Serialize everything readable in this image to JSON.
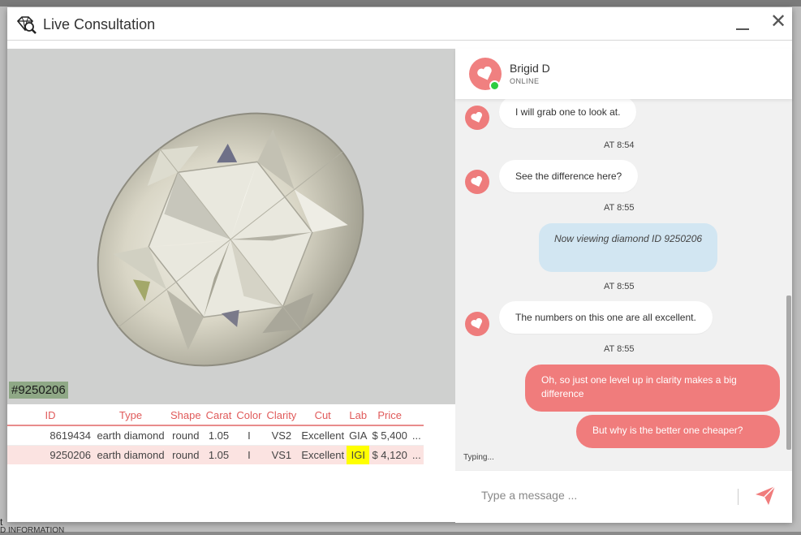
{
  "window": {
    "title": "Live Consultation"
  },
  "viewer": {
    "diamond_id_tag": "#9250206"
  },
  "table": {
    "headers": [
      "ID",
      "Type",
      "Shape",
      "Carat",
      "Color",
      "Clarity",
      "Cut",
      "Lab",
      "Price"
    ],
    "rows": [
      [
        "8619434",
        "earth diamond",
        "round",
        "1.05",
        "I",
        "VS2",
        "Excellent",
        "GIA",
        "$ 5,400",
        "..."
      ],
      [
        "9250206",
        "earth diamond",
        "round",
        "1.05",
        "I",
        "VS1",
        "Excellent",
        "IGI",
        "$ 4,120",
        "..."
      ]
    ]
  },
  "agent": {
    "name": "Brigid D",
    "status": "ONLINE"
  },
  "messages": [
    {
      "from": "agent",
      "text": "I will grab one to look at."
    },
    {
      "type": "timestamp",
      "text": "AT 8:54"
    },
    {
      "from": "agent",
      "text": "See the difference here?"
    },
    {
      "type": "timestamp",
      "text": "AT 8:55"
    },
    {
      "from": "system",
      "text": "Now viewing diamond ID 9250206"
    },
    {
      "type": "timestamp",
      "text": "AT 8:55"
    },
    {
      "from": "agent",
      "text": "The numbers on this one are all excellent."
    },
    {
      "type": "timestamp",
      "text": "AT 8:55"
    },
    {
      "from": "user",
      "text": "Oh, so just one level up in clarity makes a big difference"
    },
    {
      "from": "user",
      "text": "But why is the better one cheaper?"
    }
  ],
  "typing_indicator": "Typing...",
  "composer": {
    "placeholder": "Type a message ...",
    "value": ""
  },
  "colors": {
    "accent": "#f07c7c",
    "system_bubble": "#d2e6f2",
    "online": "#2ecc40",
    "lab_highlight": "#ffff00"
  },
  "icons": {
    "logo": "diamond-search-icon",
    "minimize": "minimize-icon",
    "close": "close-icon",
    "send": "paper-plane-icon",
    "avatar": "heart-icon"
  },
  "background_page": {
    "line1": "t",
    "line2": "D INFORMATION"
  }
}
